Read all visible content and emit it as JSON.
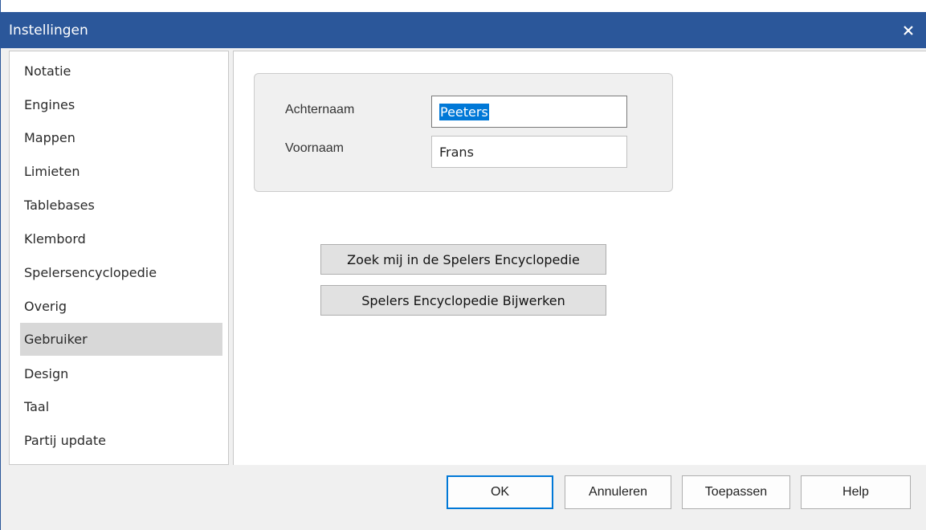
{
  "window": {
    "title": "Instellingen"
  },
  "sidebar": {
    "items": [
      {
        "label": "Notatie"
      },
      {
        "label": "Engines"
      },
      {
        "label": "Mappen"
      },
      {
        "label": "Limieten"
      },
      {
        "label": "Tablebases"
      },
      {
        "label": "Klembord"
      },
      {
        "label": "Spelersencyclopedie"
      },
      {
        "label": "Overig"
      },
      {
        "label": "Gebruiker",
        "selected": true
      },
      {
        "label": "Design"
      },
      {
        "label": "Taal"
      },
      {
        "label": "Partij update"
      }
    ]
  },
  "form": {
    "lastname_label": "Achternaam",
    "lastname_value": "Peeters",
    "firstname_label": "Voornaam",
    "firstname_value": "Frans"
  },
  "actions": {
    "find_me_label": "Zoek mij in de Spelers Encyclopedie",
    "update_label": "Spelers Encyclopedie Bijwerken"
  },
  "footer": {
    "ok_label": "OK",
    "cancel_label": "Annuleren",
    "apply_label": "Toepassen",
    "help_label": "Help"
  },
  "colors": {
    "titlebar": "#2b579a",
    "selection": "#0078d7",
    "selected_item": "#d8d8d8"
  },
  "icons": {
    "close": "close-icon"
  }
}
